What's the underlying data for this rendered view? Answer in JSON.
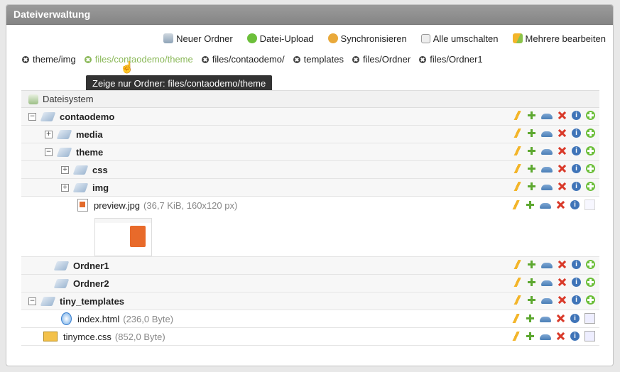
{
  "panel": {
    "title": "Dateiverwaltung"
  },
  "toolbar": {
    "items": [
      {
        "label": "Neuer Ordner",
        "icon": "new-folder-icon"
      },
      {
        "label": "Datei-Upload",
        "icon": "upload-icon"
      },
      {
        "label": "Synchronisieren",
        "icon": "sync-icon"
      },
      {
        "label": "Alle umschalten",
        "icon": "toggle-all-icon"
      },
      {
        "label": "Mehrere bearbeiten",
        "icon": "edit-multiple-icon"
      }
    ]
  },
  "breadcrumbs": [
    {
      "label": "theme/img"
    },
    {
      "label": "files/contaodemo/theme",
      "active": true
    },
    {
      "label": "files/contaodemo/"
    },
    {
      "label": "templates"
    },
    {
      "label": "files/Ordner"
    },
    {
      "label": "files/Ordner1"
    }
  ],
  "tooltip": "Zeige nur Ordner: files/contaodemo/theme",
  "tree": {
    "root_label": "Dateisystem",
    "rows": [
      {
        "name": "contaodemo",
        "meta": ""
      },
      {
        "name": "media",
        "meta": ""
      },
      {
        "name": "theme",
        "meta": ""
      },
      {
        "name": "css",
        "meta": ""
      },
      {
        "name": "img",
        "meta": ""
      },
      {
        "name": "preview.jpg",
        "meta": "(36,7 KiB, 160x120 px)"
      },
      {
        "name": "Ordner1",
        "meta": ""
      },
      {
        "name": "Ordner2",
        "meta": ""
      },
      {
        "name": "tiny_templates",
        "meta": ""
      },
      {
        "name": "index.html",
        "meta": "(236,0 Byte)"
      },
      {
        "name": "tinymce.css",
        "meta": "(852,0 Byte)"
      }
    ]
  },
  "colors": {
    "header": "#8c8c8c",
    "active_crumb": "#8ab858"
  }
}
